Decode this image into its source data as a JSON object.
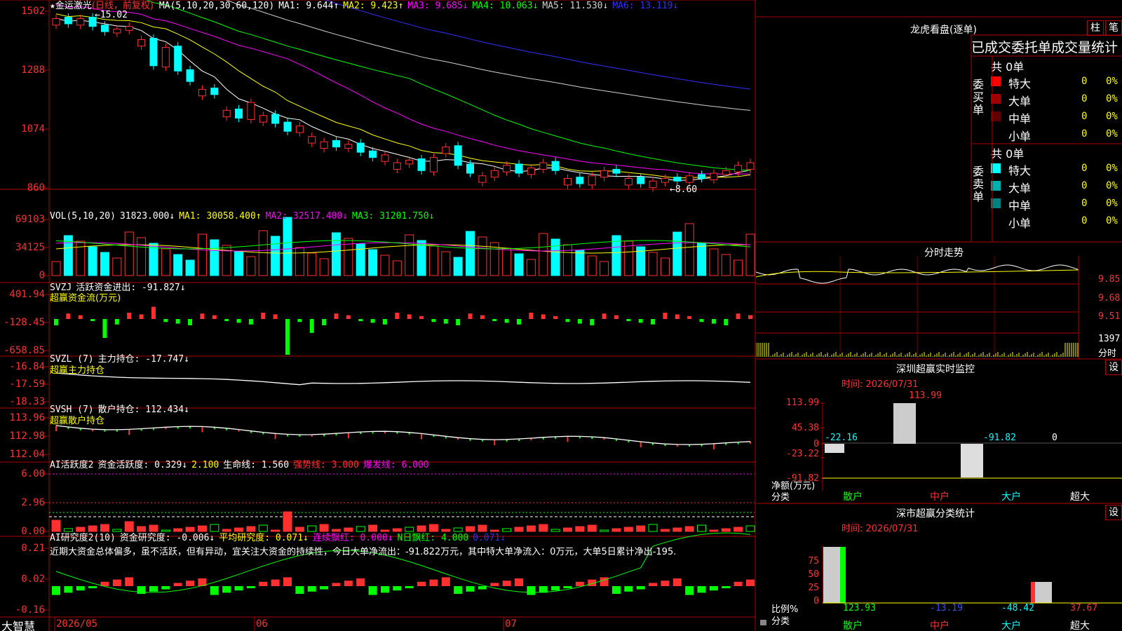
{
  "stock": {
    "name": "金运激光",
    "period": "(日线，前复权)"
  },
  "price": {
    "ma_header": [
      {
        "t": "MA(5,10,20,30,60,120)",
        "c": "#ffffff"
      },
      {
        "t": "MA1: 9.644↑",
        "c": "#ffffff"
      },
      {
        "t": "MA2: 9.423↑",
        "c": "#ffff00"
      },
      {
        "t": "MA3: 9.685↓",
        "c": "#ff00ff"
      },
      {
        "t": "MA4: 10.063↓",
        "c": "#00ff00"
      },
      {
        "t": "MA5: 11.530↓",
        "c": "#d0d0d0"
      },
      {
        "t": "MA6: 13.119↓",
        "c": "#3030ff"
      }
    ],
    "yticks": [
      "1502",
      "1288",
      "1074",
      "860"
    ],
    "high_label": "15.02",
    "low_label": "8.60"
  },
  "vol": {
    "header": [
      {
        "t": "VOL(5,10,20)",
        "c": "#ffffff"
      },
      {
        "t": "31823.000↓",
        "c": "#ffffff"
      },
      {
        "t": "MA1: 30058.400↑",
        "c": "#ffff00"
      },
      {
        "t": "MA2: 32517.400↓",
        "c": "#ff00ff"
      },
      {
        "t": "MA3: 31201.750↓",
        "c": "#00ff00"
      }
    ],
    "yticks": [
      "69103",
      "34125",
      "0"
    ]
  },
  "svzj": {
    "header": [
      {
        "t": "SVZJ",
        "c": "#ffffff"
      },
      {
        "t": "活跃资金进出: -91.827↓",
        "c": "#ffffff"
      }
    ],
    "sub": "超赢资金流(万元)",
    "yticks": [
      "401.94",
      "-128.45",
      "-658.85"
    ]
  },
  "svzl": {
    "header": [
      {
        "t": "SVZL (7)",
        "c": "#ffffff"
      },
      {
        "t": "主力持仓: -17.747↓",
        "c": "#ffffff"
      }
    ],
    "sub": "超赢主力持仓",
    "yticks": [
      "-16.84",
      "-17.59",
      "-18.33"
    ]
  },
  "svsh": {
    "header": [
      {
        "t": "SVSH (7)",
        "c": "#ffffff"
      },
      {
        "t": "散户持仓: 112.434↓",
        "c": "#ffffff"
      }
    ],
    "sub": "超赢散户持仓",
    "yticks": [
      "113.96",
      "112.98",
      "112.04"
    ]
  },
  "ai2": {
    "header": [
      {
        "t": "AI活跃度2",
        "c": "#ffffff"
      },
      {
        "t": "资金活跃度: 0.329↓",
        "c": "#ffffff"
      },
      {
        "t": "2.100",
        "c": "#ffff00"
      },
      {
        "t": "生命线: 1.560",
        "c": "#ffffff"
      },
      {
        "t": "强势线: 3.000",
        "c": "#ff3030"
      },
      {
        "t": "爆发线: 6.000",
        "c": "#ff00ff"
      }
    ],
    "yticks": [
      "6.00",
      "2.96",
      "0.00"
    ]
  },
  "ai_study": {
    "header": [
      {
        "t": "AI研究度2(10)",
        "c": "#ffffff"
      },
      {
        "t": "资金研究度: -0.006↓",
        "c": "#ffffff"
      },
      {
        "t": "平均研究度: 0.071↓",
        "c": "#ffff00"
      },
      {
        "t": "连续飘红: 0.000↓",
        "c": "#ff00ff"
      },
      {
        "t": "N日飘红: 4.000",
        "c": "#00ff00"
      },
      {
        "t": "0.071↓",
        "c": "#3030ff"
      }
    ],
    "comment": "近期大资金总体偏多，虽不活跃，但有异动，宜关注大资金的持续性，今日大单净流出：-91.822万元，其中特大单净流入：0万元，大单5日累计净出-195.",
    "yticks": [
      "0.21",
      "0.02",
      "-0.16"
    ]
  },
  "bottom": {
    "brand": "大智慧",
    "dates": [
      "2026/05",
      "06",
      "07"
    ]
  },
  "right": {
    "title": "龙虎看盘(逐单)",
    "btn1": "柱",
    "btn2": "笔",
    "section_title": "已成交委托单成交量统计",
    "buy": {
      "label": "委买单",
      "total": "共 0单",
      "rows": [
        {
          "name": "特大",
          "n": "0",
          "p": "0%",
          "c": "#ff0000"
        },
        {
          "name": "大单",
          "n": "0",
          "p": "0%",
          "c": "#a00000"
        },
        {
          "name": "中单",
          "n": "0",
          "p": "0%",
          "c": "#600000"
        },
        {
          "name": "小单",
          "n": "0",
          "p": "0%",
          "c": "#000000"
        }
      ]
    },
    "sell": {
      "label": "委卖单",
      "total": "共 0单",
      "rows": [
        {
          "name": "特大",
          "n": "0",
          "p": "0%",
          "c": "#00ffff"
        },
        {
          "name": "大单",
          "n": "0",
          "p": "0%",
          "c": "#00b0b0"
        },
        {
          "name": "中单",
          "n": "0",
          "p": "0%",
          "c": "#008080"
        },
        {
          "name": "小单",
          "n": "0",
          "p": "0%",
          "c": "#000000"
        }
      ]
    },
    "intraday": {
      "title": "分时走势",
      "yticks": [
        "9.85",
        "9.68",
        "9.51"
      ],
      "vol_label": "1397",
      "vol_unit": "分时"
    },
    "sz_monitor": {
      "title": "深圳超赢实时监控",
      "setting": "设",
      "time": "时间: 2026/07/31",
      "yticks": [
        "113.99",
        "45.38",
        "0",
        "-23.22",
        "-91.82"
      ],
      "values": [
        {
          "cat": "散户",
          "v": "-22.16"
        },
        {
          "cat": "中户",
          "v": "113.99"
        },
        {
          "cat": "大户",
          "v": "-91.82"
        },
        {
          "cat": "超大",
          "v": "0"
        }
      ],
      "unit": "净额(万元)",
      "xlabel": "分类"
    },
    "sz_class": {
      "title": "深市超赢分类统计",
      "setting": "设",
      "time": "时间: 2026/07/31",
      "yticks": [
        "75",
        "50",
        "25",
        "0"
      ],
      "values": [
        {
          "cat": "散户",
          "v": "123.93",
          "c": "#00ff00"
        },
        {
          "cat": "中户",
          "v": "-13.19",
          "c": "#3050ff"
        },
        {
          "cat": "大户",
          "v": "-48.42",
          "c": "#00ffff"
        },
        {
          "cat": "超大",
          "v": "37.67",
          "c": "#ff3030"
        }
      ],
      "unit": "比例%",
      "xlabel": "分类"
    }
  },
  "chart_data": {
    "type": "candlestick",
    "note": "K线图 金运激光 日线 前复权",
    "close": [
      14.9,
      14.7,
      14.9,
      14.6,
      14.4,
      14.5,
      14.6,
      14.1,
      13.1,
      13.8,
      12.9,
      12.5,
      12.2,
      12.0,
      11.4,
      11.1,
      11.7,
      11.2,
      10.9,
      10.6,
      10.8,
      10.4,
      10.2,
      10.0,
      10.1,
      9.8,
      9.6,
      9.7,
      9.4,
      9.5,
      9.1,
      9.6,
      10.0,
      9.3,
      9.0,
      8.9,
      9.1,
      9.3,
      9.0,
      9.2,
      9.4,
      9.1,
      8.8,
      8.6,
      8.9,
      9.1,
      9.0,
      8.8,
      8.6,
      8.7,
      8.8,
      8.7,
      8.9,
      8.8,
      9.0,
      9.1,
      9.3,
      9.4
    ]
  }
}
